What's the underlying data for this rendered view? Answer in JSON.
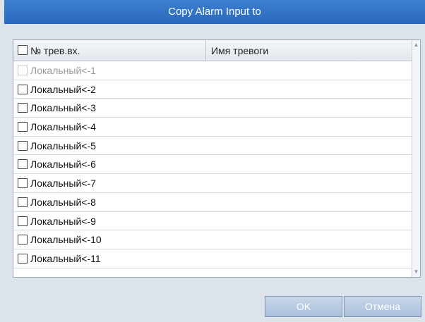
{
  "dialog": {
    "title": "Copy Alarm Input to"
  },
  "table": {
    "columns": [
      "№ трев.вх.",
      "Имя тревоги"
    ],
    "rows": [
      {
        "label": "Локальный<-1",
        "enabled": false
      },
      {
        "label": "Локальный<-2",
        "enabled": true
      },
      {
        "label": "Локальный<-3",
        "enabled": true
      },
      {
        "label": "Локальный<-4",
        "enabled": true
      },
      {
        "label": "Локальный<-5",
        "enabled": true
      },
      {
        "label": "Локальный<-6",
        "enabled": true
      },
      {
        "label": "Локальный<-7",
        "enabled": true
      },
      {
        "label": "Локальный<-8",
        "enabled": true
      },
      {
        "label": "Локальный<-9",
        "enabled": true
      },
      {
        "label": "Локальный<-10",
        "enabled": true
      },
      {
        "label": "Локальный<-11",
        "enabled": true
      }
    ]
  },
  "buttons": {
    "ok": "OK",
    "cancel": "Отмена"
  },
  "colors": {
    "title_bar": "#2f72c6",
    "background": "#dde3ea",
    "button": "#b8cbe2"
  }
}
